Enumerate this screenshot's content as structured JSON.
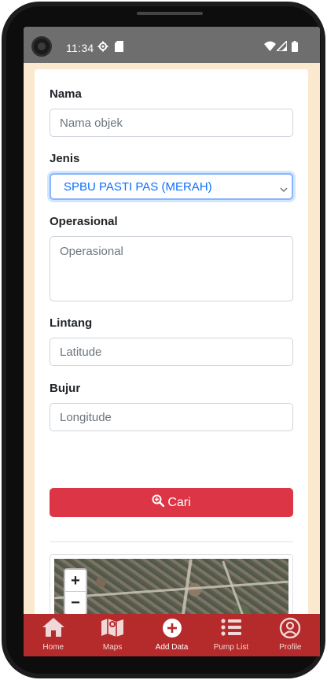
{
  "status_bar": {
    "time": "11:34",
    "icons": [
      "gear-icon",
      "sd-card-icon",
      "wifi-icon",
      "signal-icon",
      "battery-icon"
    ]
  },
  "form": {
    "nama": {
      "label": "Nama",
      "placeholder": "Nama objek",
      "value": ""
    },
    "jenis": {
      "label": "Jenis",
      "selected": "SPBU PASTI PAS (MERAH)"
    },
    "operasional": {
      "label": "Operasional",
      "placeholder": "Operasional",
      "value": ""
    },
    "lintang": {
      "label": "Lintang",
      "placeholder": "Latitude",
      "value": ""
    },
    "bujur": {
      "label": "Bujur",
      "placeholder": "Longitude",
      "value": ""
    },
    "search_button": {
      "label": "Cari",
      "icon": "search-plus-icon"
    }
  },
  "map": {
    "zoom_in": "+",
    "zoom_out": "−",
    "controls": [
      "zoom-in",
      "zoom-out",
      "locate-icon"
    ]
  },
  "bottom_nav": {
    "items": [
      {
        "label": "Home",
        "icon": "home-icon",
        "active": false
      },
      {
        "label": "Maps",
        "icon": "map-icon",
        "active": false
      },
      {
        "label": "Add Data",
        "icon": "plus-circle-icon",
        "active": true
      },
      {
        "label": "Pump List",
        "icon": "list-icon",
        "active": false
      },
      {
        "label": "Profile",
        "icon": "user-circle-icon",
        "active": false
      }
    ]
  },
  "colors": {
    "primary_button": "#dc3545",
    "bottom_nav": "#b52a2a",
    "page_background": "#fbe9cf",
    "select_text": "#0d6efd",
    "status_bar": "#6e6e6e"
  }
}
